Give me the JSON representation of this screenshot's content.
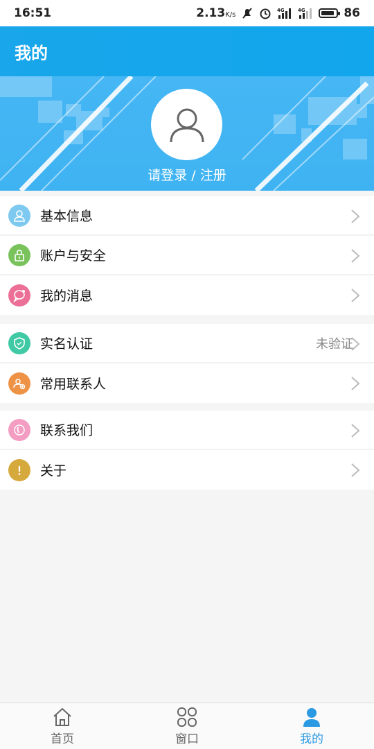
{
  "status_bar": {
    "time": "16:51",
    "speed": "2.13",
    "speed_unit": "K/s",
    "battery": "86",
    "battery_level_percent": 86
  },
  "header": {
    "title": "我的"
  },
  "profile": {
    "login_text": "请登录 / 注册"
  },
  "menu_groups": [
    [
      {
        "label": "基本信息",
        "icon": "user-icon",
        "color": "#7ec9f0"
      },
      {
        "label": "账户与安全",
        "icon": "lock-icon",
        "color": "#7ac35c"
      },
      {
        "label": "我的消息",
        "icon": "message-icon",
        "color": "#ec6f97"
      }
    ],
    [
      {
        "label": "实名认证",
        "icon": "shield-icon",
        "color": "#3fc9a4",
        "value": "未验证"
      },
      {
        "label": "常用联系人",
        "icon": "contacts-icon",
        "color": "#ee9345"
      }
    ],
    [
      {
        "label": "联系我们",
        "icon": "phone-icon",
        "color": "#f39dc2"
      },
      {
        "label": "关于",
        "icon": "info-icon",
        "color": "#d5a93c"
      }
    ]
  ],
  "bottom_nav": [
    {
      "label": "首页",
      "icon": "home-icon"
    },
    {
      "label": "窗口",
      "icon": "grid-icon"
    },
    {
      "label": "我的",
      "icon": "person-icon",
      "active": true
    }
  ],
  "colors": {
    "accent": "#12a6ec",
    "active_nav": "#2b9ae3"
  }
}
